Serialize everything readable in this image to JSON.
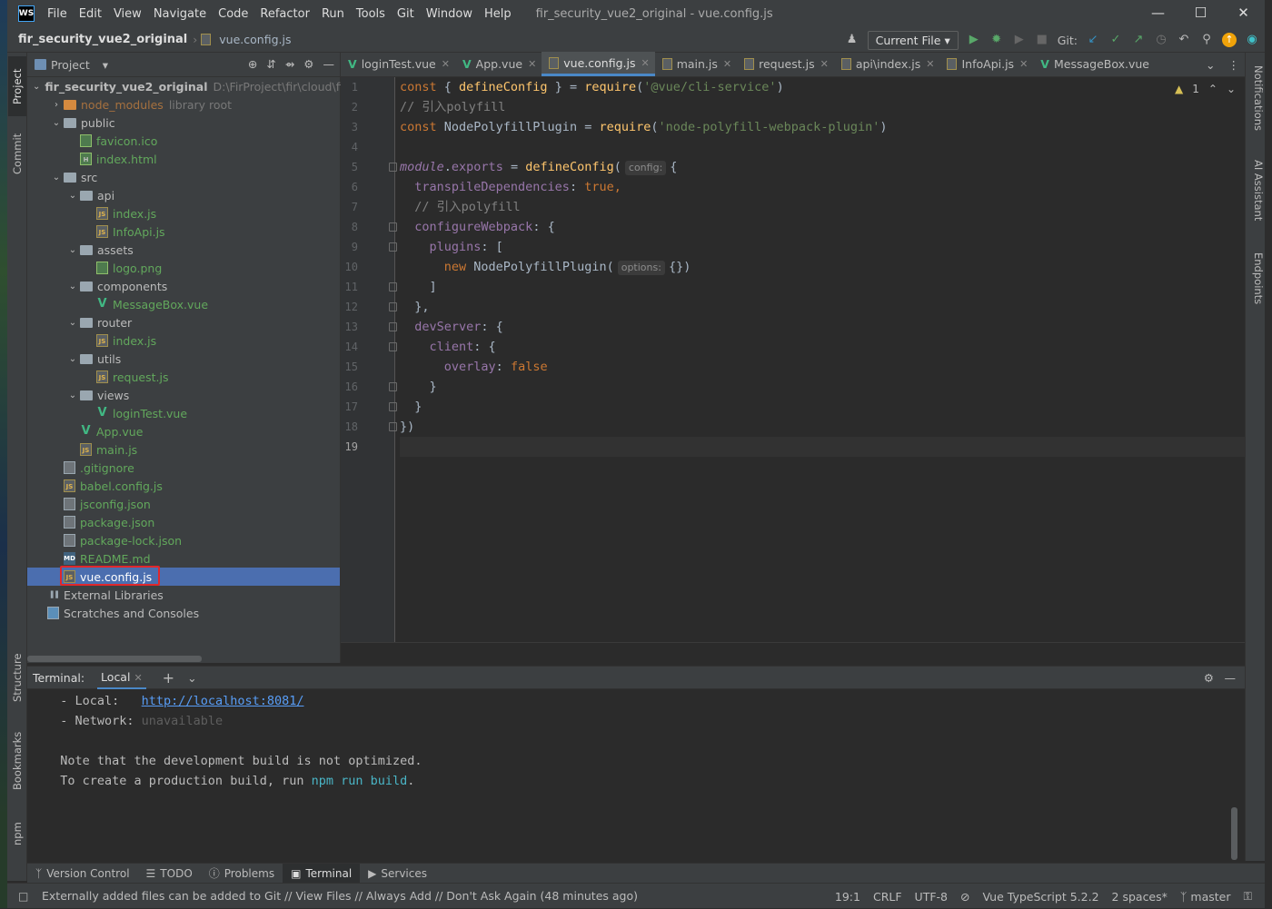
{
  "app": {
    "logo": "WS",
    "menu": [
      "File",
      "Edit",
      "View",
      "Navigate",
      "Code",
      "Refactor",
      "Run",
      "Tools",
      "Git",
      "Window",
      "Help"
    ],
    "window_title": "fir_security_vue2_original - vue.config.js"
  },
  "navbar": {
    "project": "fir_security_vue2_original",
    "file": "vue.config.js",
    "run_config": "Current File",
    "git_label": "Git:"
  },
  "left_stripe": [
    "Project",
    "Commit",
    "Structure",
    "Bookmarks",
    "npm"
  ],
  "right_stripe": [
    "Notifications",
    "AI Assistant",
    "Endpoints"
  ],
  "project_panel": {
    "title": "Project",
    "tree": [
      {
        "depth": 0,
        "arrow": "v",
        "kind": "folder",
        "name": "fir_security_vue2_original",
        "extra": "D:\\FirProject\\fir\\cloud\\fir",
        "bold": true
      },
      {
        "depth": 1,
        "arrow": ">",
        "kind": "folder-orange",
        "name": "node_modules",
        "extra": "library root",
        "color": "orange"
      },
      {
        "depth": 1,
        "arrow": "v",
        "kind": "folder",
        "name": "public"
      },
      {
        "depth": 2,
        "arrow": "",
        "kind": "ico",
        "name": "favicon.ico",
        "color": "green"
      },
      {
        "depth": 2,
        "arrow": "",
        "kind": "html",
        "name": "index.html",
        "color": "green"
      },
      {
        "depth": 1,
        "arrow": "v",
        "kind": "folder",
        "name": "src"
      },
      {
        "depth": 2,
        "arrow": "v",
        "kind": "folder",
        "name": "api"
      },
      {
        "depth": 3,
        "arrow": "",
        "kind": "js",
        "name": "index.js",
        "color": "green"
      },
      {
        "depth": 3,
        "arrow": "",
        "kind": "js",
        "name": "InfoApi.js",
        "color": "green"
      },
      {
        "depth": 2,
        "arrow": "v",
        "kind": "folder",
        "name": "assets"
      },
      {
        "depth": 3,
        "arrow": "",
        "kind": "ico",
        "name": "logo.png",
        "color": "green"
      },
      {
        "depth": 2,
        "arrow": "v",
        "kind": "folder",
        "name": "components"
      },
      {
        "depth": 3,
        "arrow": "",
        "kind": "vue",
        "name": "MessageBox.vue",
        "color": "green"
      },
      {
        "depth": 2,
        "arrow": "v",
        "kind": "folder",
        "name": "router"
      },
      {
        "depth": 3,
        "arrow": "",
        "kind": "js",
        "name": "index.js",
        "color": "green"
      },
      {
        "depth": 2,
        "arrow": "v",
        "kind": "folder",
        "name": "utils"
      },
      {
        "depth": 3,
        "arrow": "",
        "kind": "js",
        "name": "request.js",
        "color": "green"
      },
      {
        "depth": 2,
        "arrow": "v",
        "kind": "folder",
        "name": "views"
      },
      {
        "depth": 3,
        "arrow": "",
        "kind": "vue",
        "name": "loginTest.vue",
        "color": "green"
      },
      {
        "depth": 2,
        "arrow": "",
        "kind": "vue",
        "name": "App.vue",
        "color": "green"
      },
      {
        "depth": 2,
        "arrow": "",
        "kind": "js",
        "name": "main.js",
        "color": "green"
      },
      {
        "depth": 1,
        "arrow": "",
        "kind": "gen",
        "name": ".gitignore",
        "color": "green"
      },
      {
        "depth": 1,
        "arrow": "",
        "kind": "js",
        "name": "babel.config.js",
        "color": "green"
      },
      {
        "depth": 1,
        "arrow": "",
        "kind": "gen",
        "name": "jsconfig.json",
        "color": "green"
      },
      {
        "depth": 1,
        "arrow": "",
        "kind": "gen",
        "name": "package.json",
        "color": "green"
      },
      {
        "depth": 1,
        "arrow": "",
        "kind": "gen",
        "name": "package-lock.json",
        "color": "green"
      },
      {
        "depth": 1,
        "arrow": "",
        "kind": "md",
        "name": "README.md",
        "color": "green"
      },
      {
        "depth": 1,
        "arrow": "",
        "kind": "js",
        "name": "vue.config.js",
        "color": "white",
        "selected": true
      },
      {
        "depth": 0,
        "arrow": "",
        "kind": "lib",
        "name": "External Libraries"
      },
      {
        "depth": 0,
        "arrow": "",
        "kind": "scratch",
        "name": "Scratches and Consoles"
      }
    ]
  },
  "editor_tabs": [
    {
      "type": "vue",
      "label": "loginTest.vue"
    },
    {
      "type": "vue",
      "label": "App.vue"
    },
    {
      "type": "js",
      "label": "vue.config.js",
      "active": true
    },
    {
      "type": "js",
      "label": "main.js"
    },
    {
      "type": "js",
      "label": "request.js"
    },
    {
      "type": "js",
      "label": "api\\index.js"
    },
    {
      "type": "js",
      "label": "InfoApi.js"
    },
    {
      "type": "vue",
      "label": "MessageBox.vue"
    }
  ],
  "editor": {
    "warning_count": "1",
    "lines": [
      "1",
      "2",
      "3",
      "4",
      "5",
      "6",
      "7",
      "8",
      "9",
      "10",
      "11",
      "12",
      "13",
      "14",
      "15",
      "16",
      "17",
      "18",
      "19"
    ],
    "code": {
      "l1_a": "const",
      "l1_b": " { ",
      "l1_c": "defineConfig",
      "l1_d": " } = ",
      "l1_e": "require",
      "l1_f": "(",
      "l1_g": "'@vue/cli-service'",
      "l1_h": ")",
      "l2": "// 引入polyfill",
      "l3_a": "const",
      "l3_b": " NodePolyfillPlugin = ",
      "l3_c": "require",
      "l3_d": "(",
      "l3_e": "'node-polyfill-webpack-plugin'",
      "l3_f": ")",
      "l5_a": "module",
      "l5_b": ".",
      "l5_c": "exports",
      "l5_d": " = ",
      "l5_e": "defineConfig",
      "l5_f": "(",
      "l5_hint": "config:",
      "l5_g": "{",
      "l6_a": "  transpileDependencies",
      "l6_b": ": ",
      "l6_c": "true,",
      "l7": "  // 引入polyfill",
      "l8_a": "  configureWebpack",
      "l8_b": ": {",
      "l9_a": "    plugins",
      "l9_b": ": [",
      "l10_a": "      new ",
      "l10_b": "NodePolyfillPlugin(",
      "l10_hint": "options:",
      "l10_c": "{})",
      "l11": "    ]",
      "l12_a": "  },",
      "l12_b": "",
      "l13_a": "  devServer",
      "l13_b": ": {",
      "l14_a": "    client",
      "l14_b": ": {",
      "l15_a": "      overlay",
      "l15_b": ": ",
      "l15_c": "false",
      "l16": "    }",
      "l17": "  }",
      "l18": "})"
    }
  },
  "terminal": {
    "label": "Terminal:",
    "tab": "Local",
    "l1_a": "  - Local:   ",
    "l1_b": "http://localhost:8081/",
    "l2_a": "  - Network: ",
    "l2_b": "unavailable",
    "l4": "  Note that the development build is not optimized.",
    "l5_a": "  To create a production build, run ",
    "l5_b": "npm run build",
    "l5_c": "."
  },
  "tool_windows": [
    "Version Control",
    "TODO",
    "Problems",
    "Terminal",
    "Services"
  ],
  "status": {
    "message": "Externally added files can be added to Git // View Files // Always Add // Don't Ask Again (48 minutes ago)",
    "position": "19:1",
    "line_sep": "CRLF",
    "encoding": "UTF-8",
    "lang": "Vue TypeScript 5.2.2",
    "indent": "2 spaces*",
    "branch": "master"
  },
  "colors": {
    "accent": "#4a88c7",
    "selection": "#4b6eaf",
    "highlight_box": "#e0272b",
    "vue": "#41b883"
  }
}
